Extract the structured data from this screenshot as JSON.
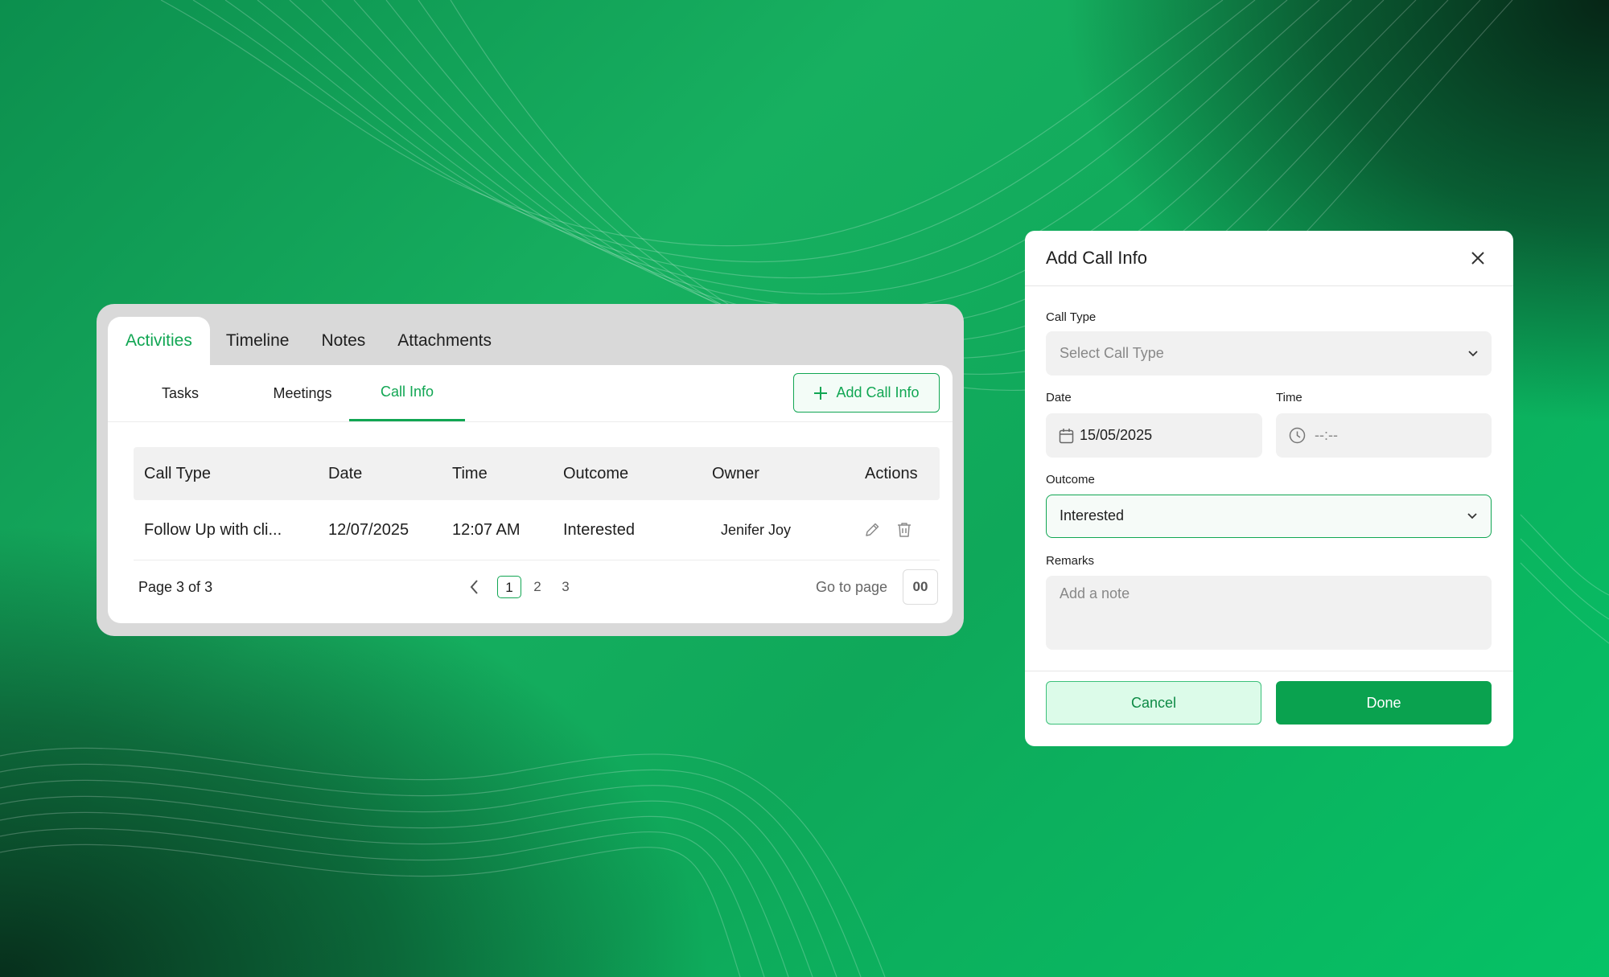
{
  "activities": {
    "main_tabs": [
      {
        "label": "Activities",
        "active": true
      },
      {
        "label": "Timeline"
      },
      {
        "label": "Notes"
      },
      {
        "label": "Attachments"
      }
    ],
    "sub_tabs": [
      {
        "label": "Tasks"
      },
      {
        "label": "Meetings"
      },
      {
        "label": "Call Info",
        "active": true
      }
    ],
    "add_button_label": "Add Call Info",
    "table": {
      "columns": [
        "Call Type",
        "Date",
        "Time",
        "Outcome",
        "Owner",
        "Actions"
      ],
      "rows": [
        {
          "call_type": "Follow Up with cli...",
          "date": "12/07/2025",
          "time": "12:07 AM",
          "outcome": "Interested",
          "owner": "Jenifer Joy"
        }
      ]
    },
    "pagination": {
      "label": "Page 3 of 3",
      "pages": [
        "1",
        "2",
        "3"
      ],
      "current": "1",
      "goto_label": "Go to page",
      "goto_value": "00"
    }
  },
  "modal": {
    "title": "Add Call Info",
    "call_type": {
      "label": "Call Type",
      "placeholder": "Select Call Type"
    },
    "date": {
      "label": "Date",
      "value": "15/05/2025"
    },
    "time": {
      "label": "Time",
      "placeholder": "--:--"
    },
    "outcome": {
      "label": "Outcome",
      "value": "Interested"
    },
    "remarks": {
      "label": "Remarks",
      "placeholder": "Add a note"
    },
    "cancel_label": "Cancel",
    "done_label": "Done"
  },
  "colors": {
    "accent": "#11a653",
    "done_button": "#0aa24f",
    "cancel_bg": "#dcfbe9"
  }
}
